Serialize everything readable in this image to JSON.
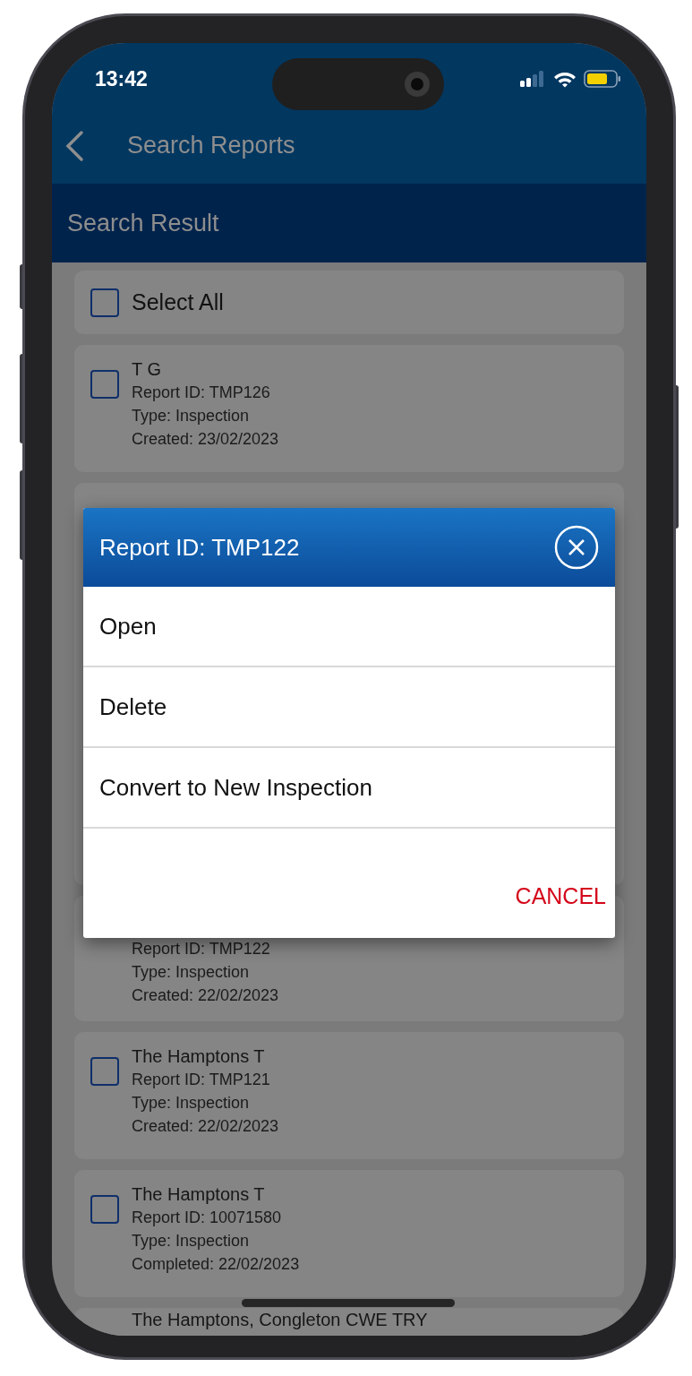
{
  "status_bar": {
    "time": "13:42"
  },
  "nav_bar": {
    "title": "Search Reports"
  },
  "section_header": {
    "title": "Search Result"
  },
  "select_all": {
    "label": "Select All",
    "checked": false
  },
  "reports": [
    {
      "title": "T  G",
      "lines": [
        "Report ID: TMP126",
        "Type: Inspection",
        "Created: 23/02/2023"
      ],
      "checked": false
    },
    {
      "kind": "covered"
    },
    {
      "lines": [
        "Report ID: TMP122",
        "Type: Inspection",
        "Created: 22/02/2023"
      ]
    },
    {
      "title": "The Hamptons   T",
      "lines": [
        "Report ID: TMP121",
        "Type: Inspection",
        "Created: 22/02/2023"
      ],
      "checked": false
    },
    {
      "title": "The Hamptons   T",
      "lines": [
        "Report ID: 10071580",
        "Type: Inspection",
        "Completed: 22/02/2023"
      ],
      "checked": false
    },
    {
      "kind": "cut",
      "title": "The Hamptons, Congleton CWE TRY"
    }
  ],
  "dialog": {
    "title": "Report ID: TMP122",
    "options": [
      "Open",
      "Delete",
      "Convert to New Inspection"
    ],
    "cancel": "CANCEL"
  }
}
